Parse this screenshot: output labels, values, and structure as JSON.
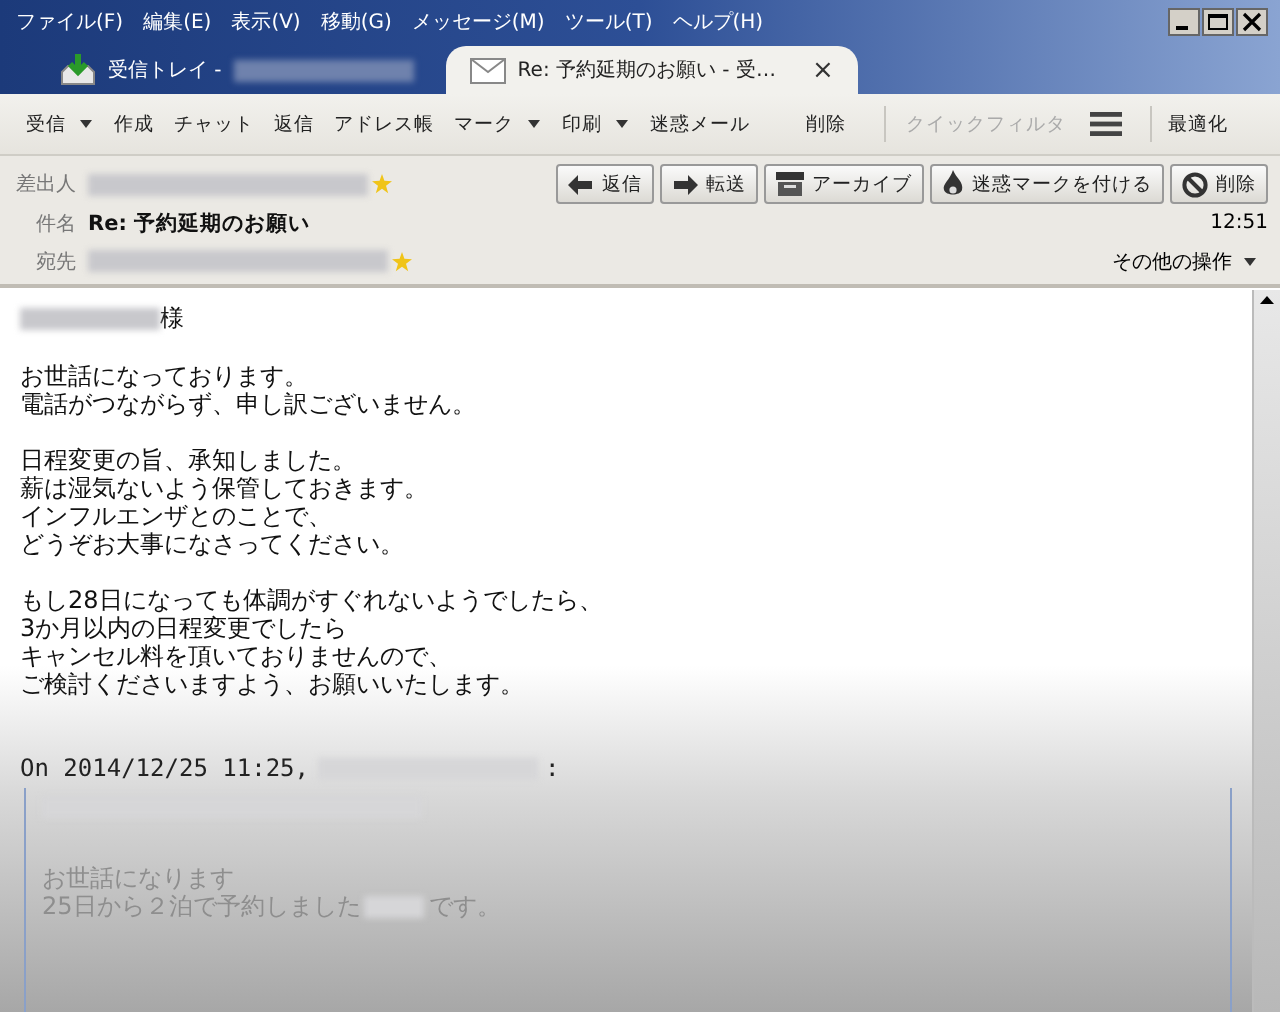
{
  "menu": [
    "ファイル(F)",
    "編集(E)",
    "表示(V)",
    "移動(G)",
    "メッセージ(M)",
    "ツール(T)",
    "ヘルプ(H)"
  ],
  "tabs": [
    {
      "kind": "inbox",
      "label": "受信トレイ -",
      "selected": false
    },
    {
      "kind": "message",
      "label": "Re: 予約延期のお願い - 受…",
      "close": "×",
      "selected": true
    }
  ],
  "toolbar": [
    {
      "label": "受信",
      "dropdown": true,
      "disabled": false
    },
    {
      "label": "作成",
      "dropdown": false,
      "disabled": false
    },
    {
      "label": "チャット",
      "dropdown": false,
      "disabled": false
    },
    {
      "label": "返信",
      "dropdown": false,
      "disabled": false
    },
    {
      "label": "アドレス帳",
      "dropdown": false,
      "disabled": false
    },
    {
      "label": "マーク",
      "dropdown": true,
      "disabled": false
    },
    {
      "label": "印刷",
      "dropdown": true,
      "disabled": false
    },
    {
      "label": "迷惑メール",
      "dropdown": false,
      "disabled": false
    },
    {
      "label": "削除",
      "dropdown": false,
      "disabled": false
    }
  ],
  "quick_filter": {
    "label": "クイックフィルタ",
    "disabled": true
  },
  "optimize": "最適化",
  "header": {
    "from_label": "差出人",
    "subject_label": "件名",
    "subject": "Re: 予約延期のお願い",
    "time": "12:51",
    "to_label": "宛先",
    "more_actions": "その他の操作",
    "buttons": [
      {
        "kind": "reply",
        "label": "返信"
      },
      {
        "kind": "forward",
        "label": "転送"
      },
      {
        "kind": "archive",
        "label": "アーカイブ"
      },
      {
        "kind": "junk",
        "label": "迷惑マークを付ける"
      },
      {
        "kind": "delete",
        "label": "削除"
      }
    ]
  },
  "body": {
    "salutation": "様",
    "paragraphs": [
      [
        "お世話になっております。",
        "電話がつながらず、申し訳ございません。"
      ],
      [
        "日程変更の旨、承知しました。",
        "薪は湿気ないよう保管しておきます。",
        "インフルエンザとのことで、",
        "どうぞお大事になさってください。"
      ],
      [
        "もし28日になっても体調がすぐれないようでしたら、",
        "3か月以内の日程変更でしたら",
        "キャンセル料を頂いておりませんので、",
        "ご検討くださいますよう、お願いいたします。"
      ]
    ],
    "quote_header": "On 2014/12/25 11:25,",
    "quote_header_end": ":",
    "quote_lines": [
      "お世話になります"
    ],
    "quote_line_start": "25日から２泊で予約しました",
    "quote_line_end": "です。"
  }
}
